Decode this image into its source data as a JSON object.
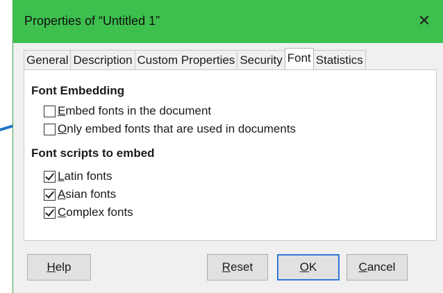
{
  "window": {
    "title": "Properties of “Untitled 1”",
    "close_glyph": "✕"
  },
  "tabs": [
    {
      "label": "General"
    },
    {
      "label": "Description"
    },
    {
      "label": "Custom Properties"
    },
    {
      "label": "Security"
    },
    {
      "label": "Font",
      "active": true
    },
    {
      "label": "Statistics"
    }
  ],
  "font_embedding": {
    "title": "Font Embedding",
    "options": [
      {
        "label": "Embed fonts in the document",
        "checked": false
      },
      {
        "label": "Only embed fonts that are used in documents",
        "checked": false
      }
    ]
  },
  "scripts": {
    "title": "Font scripts to embed",
    "options": [
      {
        "label": "Latin fonts",
        "checked": true
      },
      {
        "label": "Asian fonts",
        "checked": true
      },
      {
        "label": "Complex fonts",
        "checked": true
      }
    ]
  },
  "buttons": {
    "help": "Help",
    "reset": "Reset",
    "ok": "OK",
    "cancel": "Cancel"
  },
  "colors": {
    "titlebar": "#3ec04f",
    "annotation_arrow": "#1f74c8",
    "default_button_border": "#2f77d4"
  }
}
